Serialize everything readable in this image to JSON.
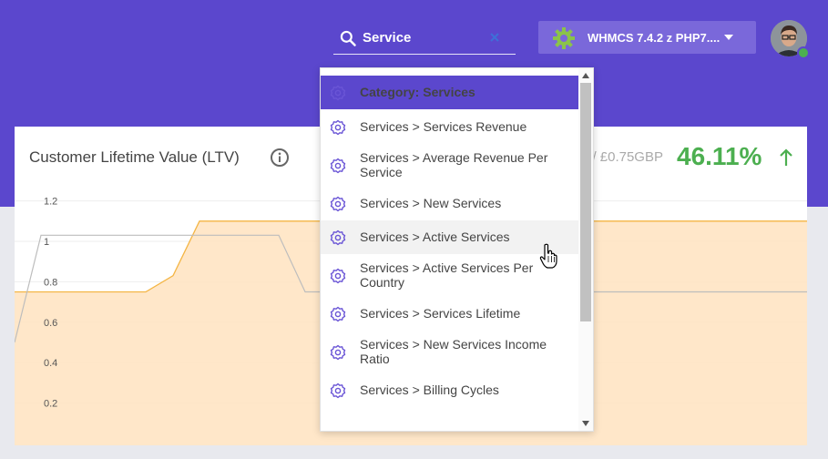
{
  "search": {
    "value": "Service",
    "placeholder": ""
  },
  "instance": {
    "label": "WHMCS 7.4.2 z PHP7...."
  },
  "card": {
    "title": "Customer Lifetime Value (LTV)",
    "previous_value": "/ £0.75GBP",
    "growth": "46.11%"
  },
  "dropdown": {
    "items": [
      {
        "label": "Category: Services",
        "header": true
      },
      {
        "label": "Services > Services Revenue"
      },
      {
        "label": "Services > Average Revenue Per Service"
      },
      {
        "label": "Services > New Services"
      },
      {
        "label": "Services > Active Services",
        "hover": true
      },
      {
        "label": "Services > Active Services Per Country"
      },
      {
        "label": "Services > Services Lifetime"
      },
      {
        "label": "Services > New Services Income Ratio"
      },
      {
        "label": "Services > Billing Cycles"
      }
    ]
  },
  "colors": {
    "header_bg": "#5b47cd",
    "accent_purple": "#6a55d6",
    "growth_green": "#4caf50",
    "area_fill": "#ffe3bf",
    "area_line": "#f4b544"
  },
  "chart_data": {
    "type": "area",
    "y_ticks": [
      "1.2",
      "1",
      "0.8",
      "0.6",
      "0.4",
      "0.2"
    ],
    "ylim": [
      0,
      1.3
    ],
    "grid": true,
    "series": [
      {
        "values": [
          0.75,
          0.75,
          0.75,
          0.75,
          0.75,
          0.75,
          0.83,
          1.1,
          1.1,
          1.1,
          1.1,
          1.1,
          1.1,
          1.1,
          1.1,
          1.1,
          1.1,
          1.1,
          1.1,
          1.1,
          1.1,
          1.1,
          1.1,
          1.1,
          1.1,
          1.1,
          1.1,
          1.1,
          1.1,
          1.1
        ]
      },
      {
        "values": [
          0.5,
          1.03,
          1.03,
          1.03,
          1.03,
          1.03,
          1.03,
          1.03,
          1.03,
          1.03,
          1.03,
          1.03,
          1.03,
          0.75,
          0.75,
          0.75,
          0.75,
          0.75,
          0.75,
          0.75,
          0.75,
          0.75,
          0.75,
          0.75,
          0.75,
          0.75,
          0.75,
          0.75,
          0.75,
          0.75
        ]
      }
    ]
  }
}
